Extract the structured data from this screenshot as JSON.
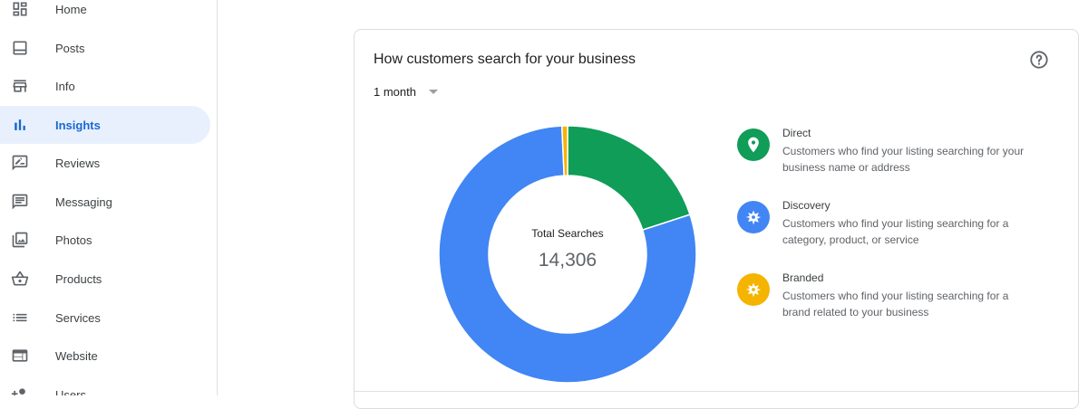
{
  "sidebar": {
    "items": [
      {
        "label": "Home",
        "icon": "dashboard-icon"
      },
      {
        "label": "Posts",
        "icon": "posts-icon"
      },
      {
        "label": "Info",
        "icon": "storefront-icon"
      },
      {
        "label": "Insights",
        "icon": "bar-chart-icon",
        "active": true
      },
      {
        "label": "Reviews",
        "icon": "rate-review-icon"
      },
      {
        "label": "Messaging",
        "icon": "message-icon"
      },
      {
        "label": "Photos",
        "icon": "photo-library-icon"
      },
      {
        "label": "Products",
        "icon": "shopping-basket-icon"
      },
      {
        "label": "Services",
        "icon": "list-icon"
      },
      {
        "label": "Website",
        "icon": "web-icon"
      },
      {
        "label": "Users",
        "icon": "person-add-icon"
      }
    ]
  },
  "card": {
    "title": "How customers search for your business",
    "period": "1 month",
    "center_label": "Total Searches",
    "center_value": "14,306",
    "legend": [
      {
        "title": "Direct",
        "desc": "Customers who find your listing searching for your business name or address",
        "color": "#0f9d58",
        "icon": "location-pin-icon"
      },
      {
        "title": "Discovery",
        "desc": "Customers who find your listing searching for a category, product, or service",
        "color": "#4285f4",
        "icon": "compass-icon"
      },
      {
        "title": "Branded",
        "desc": "Customers who find your listing searching for a brand related to your business",
        "color": "#f4b400",
        "icon": "compass-icon"
      }
    ]
  },
  "colors": {
    "direct": "#0f9d58",
    "discovery": "#4285f4",
    "branded": "#f4b400",
    "accent": "#1967d2"
  },
  "chart_data": {
    "type": "pie",
    "categories": [
      "Direct",
      "Discovery",
      "Branded"
    ],
    "values": [
      20,
      79.3,
      0.7
    ],
    "colors": [
      "#0f9d58",
      "#4285f4",
      "#f4b400"
    ]
  }
}
